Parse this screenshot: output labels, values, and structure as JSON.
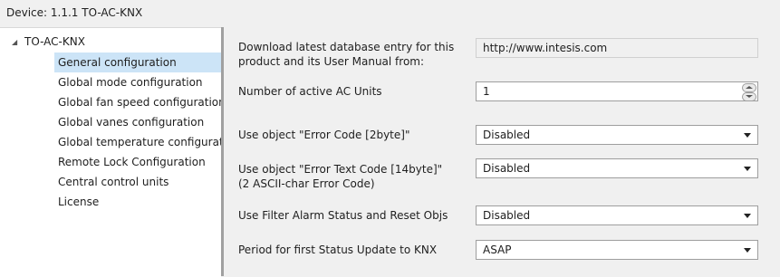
{
  "header": {
    "device_label": "Device: 1.1.1  TO-AC-KNX"
  },
  "tree": {
    "root_label": "TO-AC-KNX",
    "items": [
      {
        "label": "General configuration",
        "selected": true
      },
      {
        "label": "Global mode configuration"
      },
      {
        "label": "Global fan speed configuration"
      },
      {
        "label": "Global vanes configuration"
      },
      {
        "label": "Global temperature configurati"
      },
      {
        "label": "Remote Lock Configuration"
      },
      {
        "label": "Central control units"
      },
      {
        "label": "License"
      }
    ]
  },
  "params": {
    "download": {
      "label_line1": "Download latest database entry for this",
      "label_line2": "product and its User Manual from:",
      "value": "http://www.intesis.com"
    },
    "active_units": {
      "label": "Number of active AC Units",
      "value": "1"
    },
    "error_code": {
      "label": "Use object \"Error Code [2byte]\"",
      "value": "Disabled"
    },
    "error_text": {
      "label_line1": "Use object \"Error Text Code [14byte]\"",
      "label_line2": "(2 ASCII-char Error Code)",
      "value": "Disabled"
    },
    "filter_alarm": {
      "label": "Use Filter Alarm Status and Reset Objs",
      "value": "Disabled"
    },
    "status_update": {
      "label": "Period for first Status Update to KNX",
      "value": "ASAP"
    }
  },
  "colors": {
    "selection": "#cce4f7",
    "splitter": "#a0a0a0"
  }
}
